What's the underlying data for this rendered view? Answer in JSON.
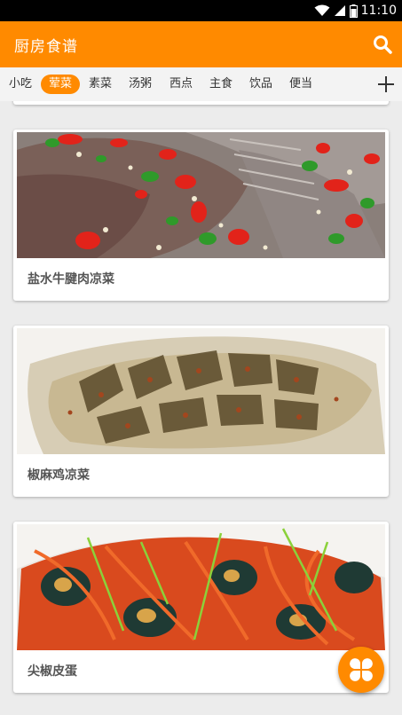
{
  "status_bar": {
    "time": "11:10",
    "icons": [
      "wifi-icon",
      "signal-icon",
      "battery-icon"
    ]
  },
  "app_bar": {
    "title": "厨房食谱",
    "search_icon": "search-icon"
  },
  "tabs": [
    {
      "label": "小吃"
    },
    {
      "label": "荤菜",
      "active": true
    },
    {
      "label": "素菜"
    },
    {
      "label": "汤粥"
    },
    {
      "label": "西点"
    },
    {
      "label": "主食"
    },
    {
      "label": "饮品"
    },
    {
      "label": "便当"
    }
  ],
  "add_icon": "plus-icon",
  "recipes": [
    {
      "title": "盐水牛腱肉凉菜"
    },
    {
      "title": "椒麻鸡凉菜"
    },
    {
      "title": "尖椒皮蛋"
    }
  ],
  "fab_icon": "four-petal-menu-icon",
  "colors": {
    "accent": "#ff8a00",
    "background": "#ececec",
    "card": "#ffffff"
  }
}
